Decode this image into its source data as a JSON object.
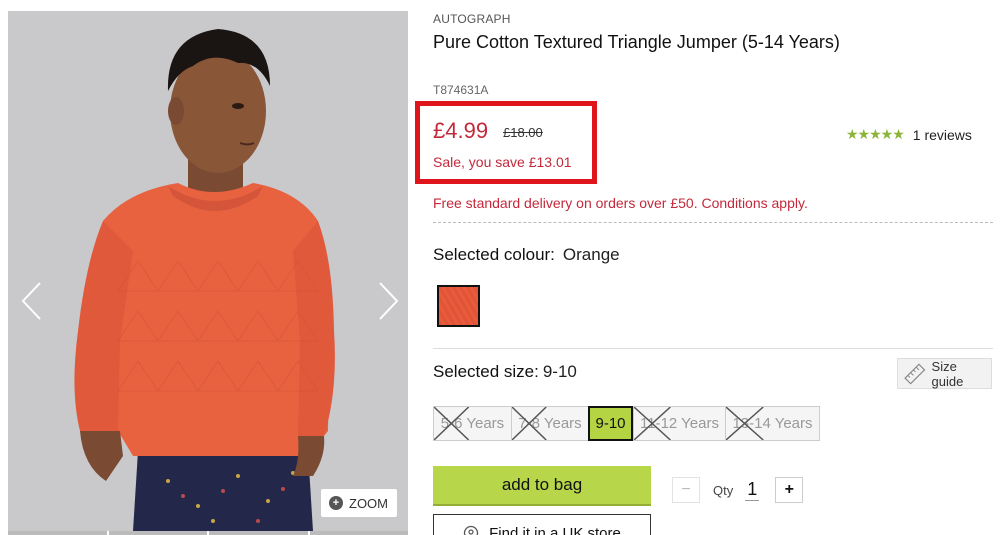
{
  "product": {
    "brand": "AUTOGRAPH",
    "title": "Pure Cotton Textured Triangle Jumper (5-14 Years)",
    "sku": "T874631A"
  },
  "price": {
    "now": "£4.99",
    "was": "£18.00",
    "saving": "Sale, you save £13.01",
    "color": "#c3293b"
  },
  "reviews": {
    "rating": 5,
    "text": "1 reviews",
    "star_color": "#8cb43a"
  },
  "delivery": "Free standard delivery on orders over £50. Conditions apply.",
  "colour": {
    "label": "Selected colour:",
    "value": "Orange",
    "swatch_color": "#ea5a3b"
  },
  "size": {
    "label": "Selected size:",
    "value": "9-10",
    "guide_label": "Size guide",
    "options": [
      {
        "label": "5-6 Years",
        "available": false,
        "selected": false
      },
      {
        "label": "7-8 Years",
        "available": false,
        "selected": false
      },
      {
        "label": "9-10",
        "available": true,
        "selected": true
      },
      {
        "label": "11-12 Years",
        "available": false,
        "selected": false
      },
      {
        "label": "13-14 Years",
        "available": false,
        "selected": false
      }
    ]
  },
  "actions": {
    "add_to_bag": "add to bag",
    "qty_label": "Qty",
    "qty_value": "1",
    "minus": "−",
    "plus": "+",
    "find_store": "Find it in a UK store"
  },
  "image": {
    "zoom_label": "ZOOM",
    "bg_color": "#c9c9cc",
    "jumper_color": "#e8623f"
  }
}
